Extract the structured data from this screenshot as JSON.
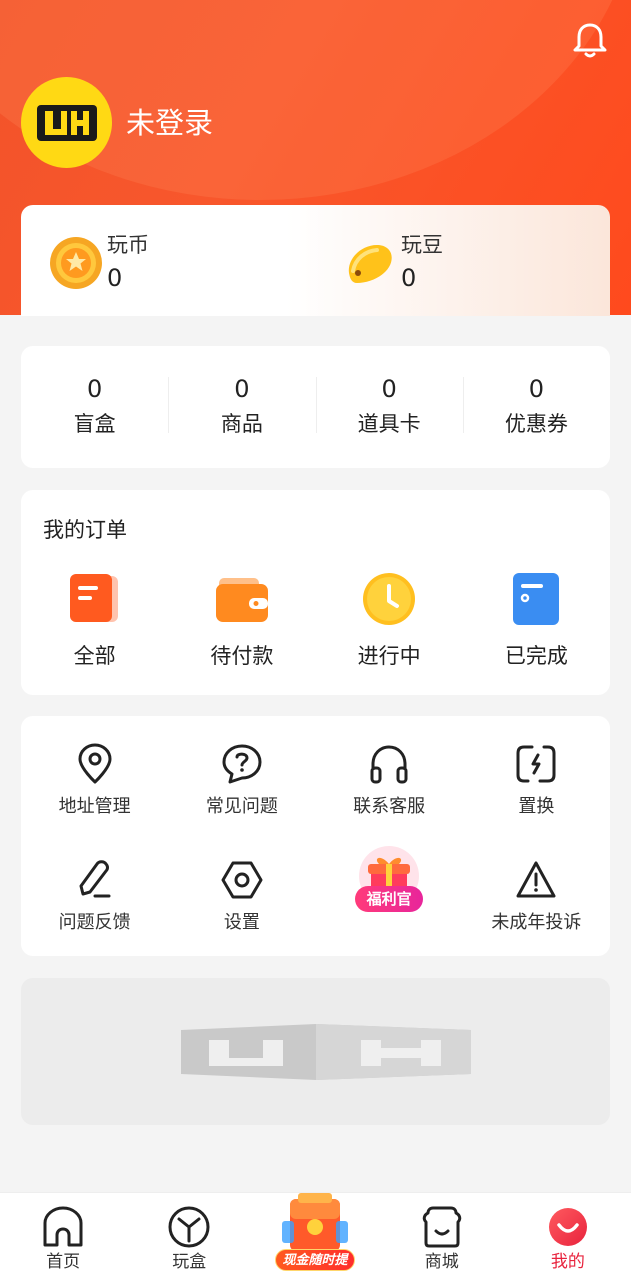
{
  "header": {
    "login_text": "未登录",
    "avatar_text": "UH"
  },
  "wallet": {
    "coins": {
      "label": "玩币",
      "value": "0"
    },
    "beans": {
      "label": "玩豆",
      "value": "0"
    }
  },
  "stats": [
    {
      "value": "0",
      "label": "盲盒"
    },
    {
      "value": "0",
      "label": "商品"
    },
    {
      "value": "0",
      "label": "道具卡"
    },
    {
      "value": "0",
      "label": "优惠券"
    }
  ],
  "orders": {
    "title": "我的订单",
    "items": [
      {
        "label": "全部",
        "icon": "document-icon"
      },
      {
        "label": "待付款",
        "icon": "wallet-icon"
      },
      {
        "label": "进行中",
        "icon": "clock-icon"
      },
      {
        "label": "已完成",
        "icon": "checklist-icon"
      }
    ]
  },
  "tools": [
    {
      "label": "地址管理",
      "icon": "location-pin-icon"
    },
    {
      "label": "常见问题",
      "icon": "question-bubble-icon"
    },
    {
      "label": "联系客服",
      "icon": "headphones-icon"
    },
    {
      "label": "置换",
      "icon": "exchange-icon"
    },
    {
      "label": "问题反馈",
      "icon": "pen-icon"
    },
    {
      "label": "设置",
      "icon": "hexagon-settings-icon"
    },
    {
      "label": "福利官",
      "icon": "gift-box-icon"
    },
    {
      "label": "未成年投诉",
      "icon": "warning-icon"
    }
  ],
  "tabbar": {
    "items": [
      {
        "label": "首页",
        "icon": "home-icon"
      },
      {
        "label": "玩盒",
        "icon": "box-icon"
      },
      {
        "label": "",
        "icon": ""
      },
      {
        "label": "商城",
        "icon": "shop-icon"
      },
      {
        "label": "我的",
        "icon": "profile-icon"
      }
    ],
    "promo_label": "现金随时提",
    "active": "我的"
  },
  "colors": {
    "header": "#f8572c",
    "active_tab": "#e8233d",
    "avatar_bg": "#ffd914"
  }
}
